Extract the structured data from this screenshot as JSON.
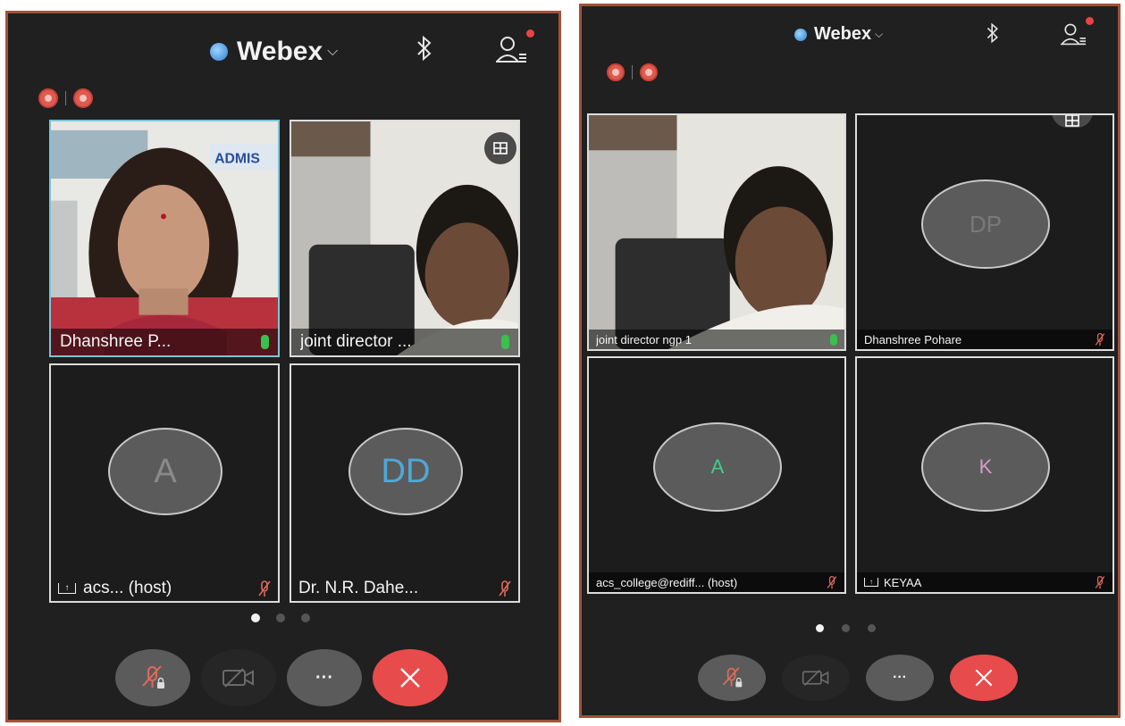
{
  "colors": {
    "frame": "#a2523a",
    "screen": "#202020",
    "end_call": "#e84b4b",
    "mic_on": "#3bbf4f",
    "mic_off": "#e06a5a",
    "initials_blue": "#4fa8d8",
    "initials_green": "#3fcf8a",
    "initials_pink": "#d99acb"
  },
  "screens": [
    {
      "app_name": "Webex",
      "page_count": 3,
      "active_page": 1,
      "tiles": [
        {
          "name": "Dhanshree P...",
          "kind": "video",
          "mic": "on",
          "active_speaker": true,
          "icons": [
            "mic-on-icon"
          ]
        },
        {
          "name": "joint director ...",
          "kind": "video",
          "mic": "on",
          "icons": [
            "mic-on-icon"
          ]
        },
        {
          "name": "acs... (host)",
          "kind": "avatar",
          "initials": "A",
          "mic": "muted",
          "share_icon": true,
          "icons": [
            "share-screen-icon",
            "mic-muted-icon"
          ]
        },
        {
          "name": "Dr. N.R. Dahe...",
          "kind": "avatar",
          "initials": "DD",
          "mic": "muted",
          "icons": [
            "mic-muted-icon"
          ]
        }
      ],
      "controls": [
        "mute-locked-button",
        "video-off-button",
        "more-button",
        "end-call-button"
      ],
      "more_label": "···"
    },
    {
      "app_name": "Webex",
      "page_count": 3,
      "active_page": 1,
      "tiles": [
        {
          "name": "joint director ngp 1",
          "kind": "video",
          "mic": "on",
          "icons": [
            "mic-on-icon"
          ]
        },
        {
          "name": "Dhanshree Pohare",
          "kind": "avatar",
          "initials": "DP",
          "mic": "muted",
          "icons": [
            "mic-muted-icon"
          ]
        },
        {
          "name": "acs_college@rediff... (host)",
          "kind": "avatar",
          "initials": "A",
          "mic": "muted",
          "icons": [
            "mic-muted-icon"
          ]
        },
        {
          "name": "KEYAA",
          "kind": "avatar",
          "initials": "K",
          "mic": "muted",
          "share_icon": true,
          "icons": [
            "share-screen-icon",
            "mic-muted-icon"
          ]
        }
      ],
      "controls": [
        "mute-locked-button",
        "video-off-button",
        "more-button",
        "end-call-button"
      ],
      "more_label": "···"
    }
  ]
}
